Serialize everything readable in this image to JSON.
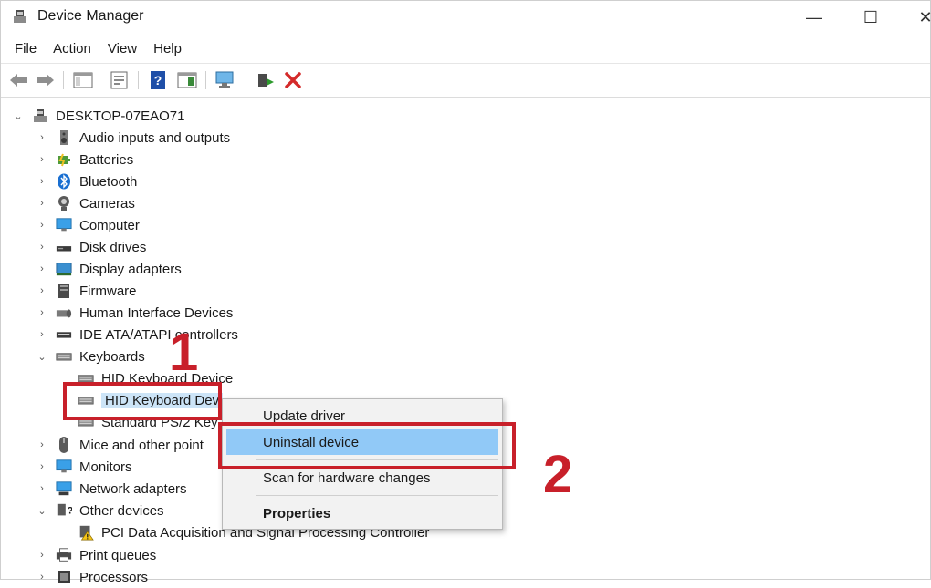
{
  "window": {
    "title": "Device Manager",
    "controls": {
      "minimize": "—",
      "maximize": "☐",
      "close": "✕"
    }
  },
  "menu": [
    "File",
    "Action",
    "View",
    "Help"
  ],
  "toolbar": [
    {
      "icon": "back-arrow-icon"
    },
    {
      "icon": "forward-arrow-icon"
    },
    {
      "icon": "show-hide-console-tree-icon"
    },
    {
      "icon": "properties-icon"
    },
    {
      "icon": "help-icon"
    },
    {
      "icon": "action-pane-icon"
    },
    {
      "icon": "scan-hardware-icon"
    },
    {
      "icon": "enable-device-icon"
    },
    {
      "icon": "uninstall-device-icon",
      "color": "#d42a2a"
    }
  ],
  "tree": {
    "root": "DESKTOP-07EAO71",
    "items": [
      {
        "label": "Audio inputs and outputs",
        "icon": "speaker-icon"
      },
      {
        "label": "Batteries",
        "icon": "battery-icon"
      },
      {
        "label": "Bluetooth",
        "icon": "bluetooth-icon"
      },
      {
        "label": "Cameras",
        "icon": "camera-icon"
      },
      {
        "label": "Computer",
        "icon": "monitor-icon"
      },
      {
        "label": "Disk drives",
        "icon": "disk-drive-icon"
      },
      {
        "label": "Display adapters",
        "icon": "display-adapter-icon"
      },
      {
        "label": "Firmware",
        "icon": "firmware-icon"
      },
      {
        "label": "Human Interface Devices",
        "icon": "hid-icon"
      },
      {
        "label": "IDE ATA/ATAPI controllers",
        "icon": "ide-controller-icon"
      },
      {
        "label": "Keyboards",
        "icon": "keyboard-icon",
        "expanded": true
      },
      {
        "label": "HID Keyboard Device",
        "icon": "keyboard-icon",
        "child": true
      },
      {
        "label": "HID Keyboard Dev",
        "icon": "keyboard-icon",
        "child": true,
        "selected": true
      },
      {
        "label": "Standard PS/2 Key",
        "icon": "keyboard-icon",
        "child": true
      },
      {
        "label": "Mice and other point",
        "icon": "mouse-icon"
      },
      {
        "label": "Monitors",
        "icon": "monitor-icon"
      },
      {
        "label": "Network adapters",
        "icon": "network-adapter-icon"
      },
      {
        "label": "Other devices",
        "icon": "other-devices-icon",
        "expanded": true
      },
      {
        "label": "PCI Data Acquisition and Signal Processing Controller",
        "icon": "warning-device-icon",
        "child": true
      },
      {
        "label": "Print queues",
        "icon": "printer-icon"
      },
      {
        "label": "Processors",
        "icon": "processor-icon"
      }
    ]
  },
  "context_menu": {
    "items": [
      "Update driver",
      "Uninstall device",
      "Scan for hardware changes",
      "Properties"
    ],
    "highlighted": "Uninstall device"
  },
  "annotations": {
    "step1": "1",
    "step2": "2",
    "color": "#c8202a"
  },
  "colors": {
    "selection": "#cce4f7",
    "menu_highlight": "#91c9f7"
  }
}
